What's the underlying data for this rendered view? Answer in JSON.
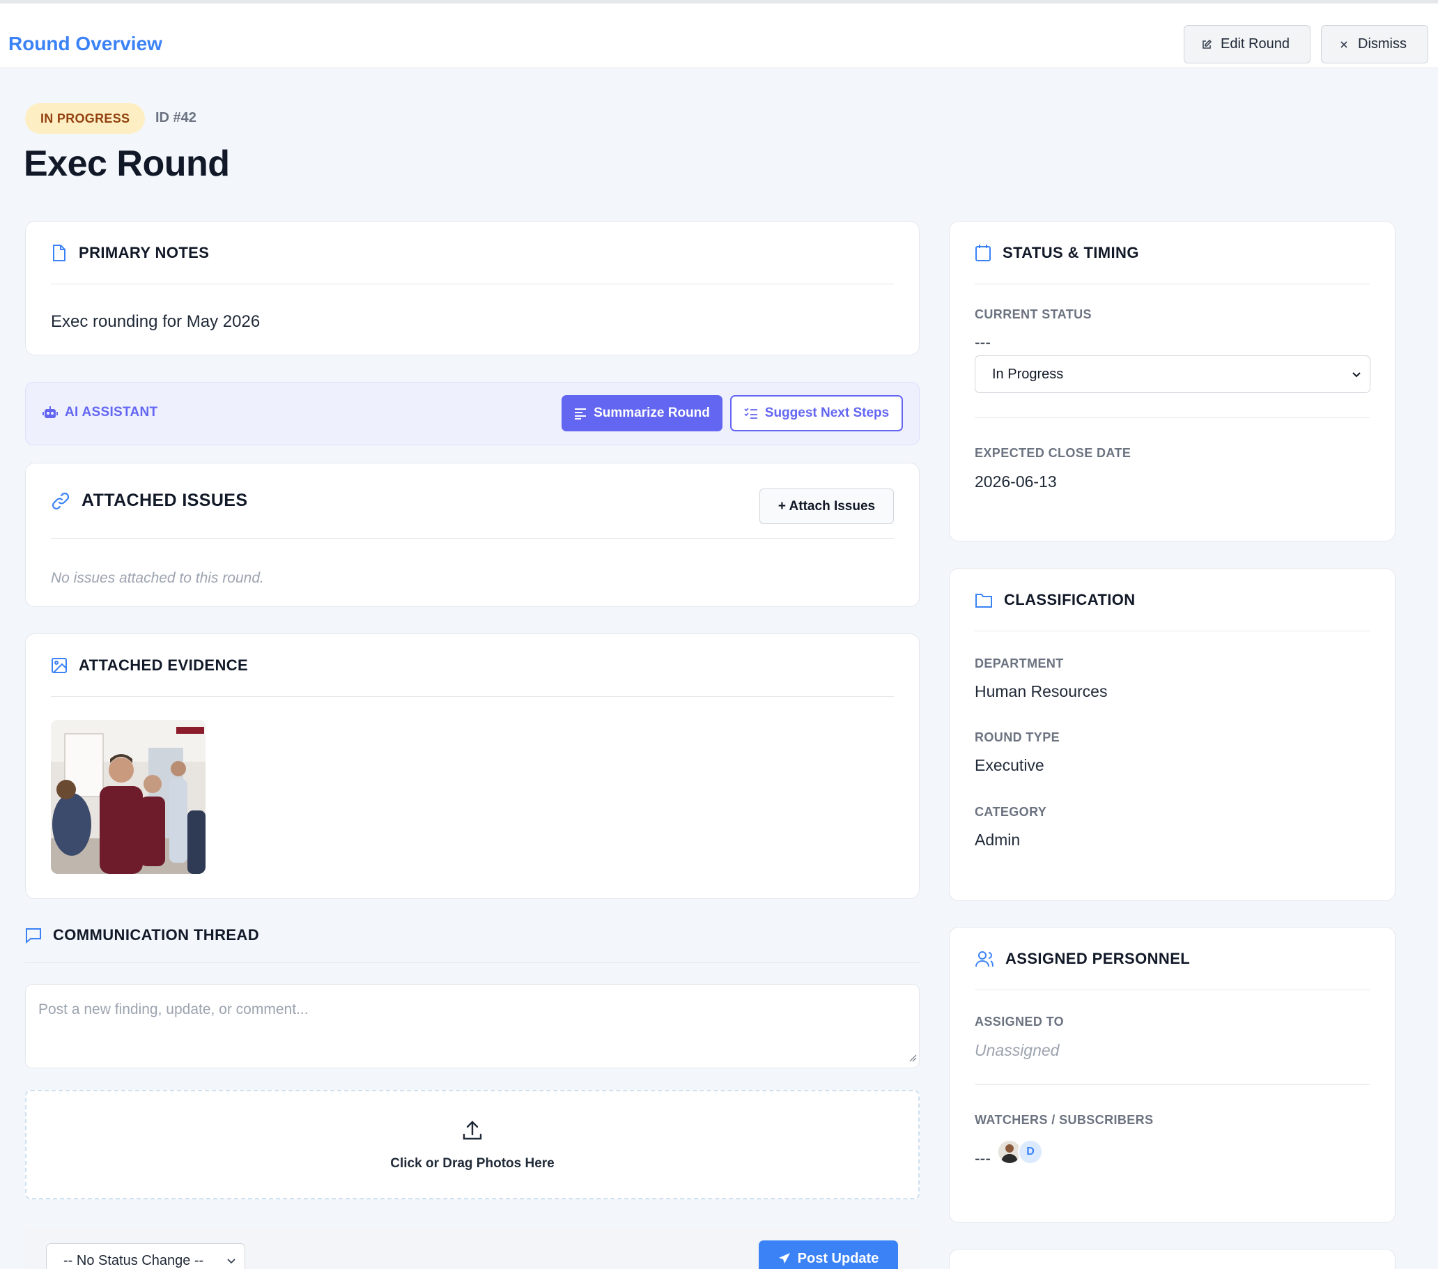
{
  "header": {
    "title": "Round Overview",
    "edit_label": "Edit Round",
    "dismiss_label": "Dismiss"
  },
  "round": {
    "status_badge": "IN PROGRESS",
    "id_label": "ID #42",
    "title": "Exec Round"
  },
  "primary_notes": {
    "heading": "PRIMARY NOTES",
    "text": "Exec rounding for May 2026"
  },
  "ai_assistant": {
    "label": "AI ASSISTANT",
    "summarize_label": "Summarize Round",
    "suggest_label": "Suggest Next Steps"
  },
  "attached_issues": {
    "heading": "ATTACHED ISSUES",
    "attach_label": "+ Attach Issues",
    "empty_text": "No issues attached to this round."
  },
  "attached_evidence": {
    "heading": "ATTACHED EVIDENCE"
  },
  "communication": {
    "heading": "COMMUNICATION THREAD",
    "placeholder": "Post a new finding, update, or comment...",
    "dropzone_text": "Click or Drag Photos Here",
    "status_select_value": "-- No Status Change --",
    "post_label": "Post Update"
  },
  "status_timing": {
    "heading": "STATUS & TIMING",
    "current_status_label": "CURRENT STATUS",
    "current_status_value": "---",
    "status_select_value": "In Progress",
    "close_date_label": "EXPECTED CLOSE DATE",
    "close_date_value": "2026-06-13"
  },
  "classification": {
    "heading": "CLASSIFICATION",
    "department_label": "DEPARTMENT",
    "department_value": "Human Resources",
    "round_type_label": "ROUND TYPE",
    "round_type_value": "Executive",
    "category_label": "CATEGORY",
    "category_value": "Admin"
  },
  "personnel": {
    "heading": "ASSIGNED PERSONNEL",
    "assigned_label": "ASSIGNED TO",
    "assigned_value": "Unassigned",
    "watchers_label": "WATCHERS / SUBSCRIBERS",
    "watchers_prefix": "---",
    "watcher_initial": "D"
  },
  "colors": {
    "accent": "#3b82f6",
    "ai_accent": "#6366f1",
    "badge_bg": "#fdefc3",
    "badge_text": "#92400e"
  }
}
